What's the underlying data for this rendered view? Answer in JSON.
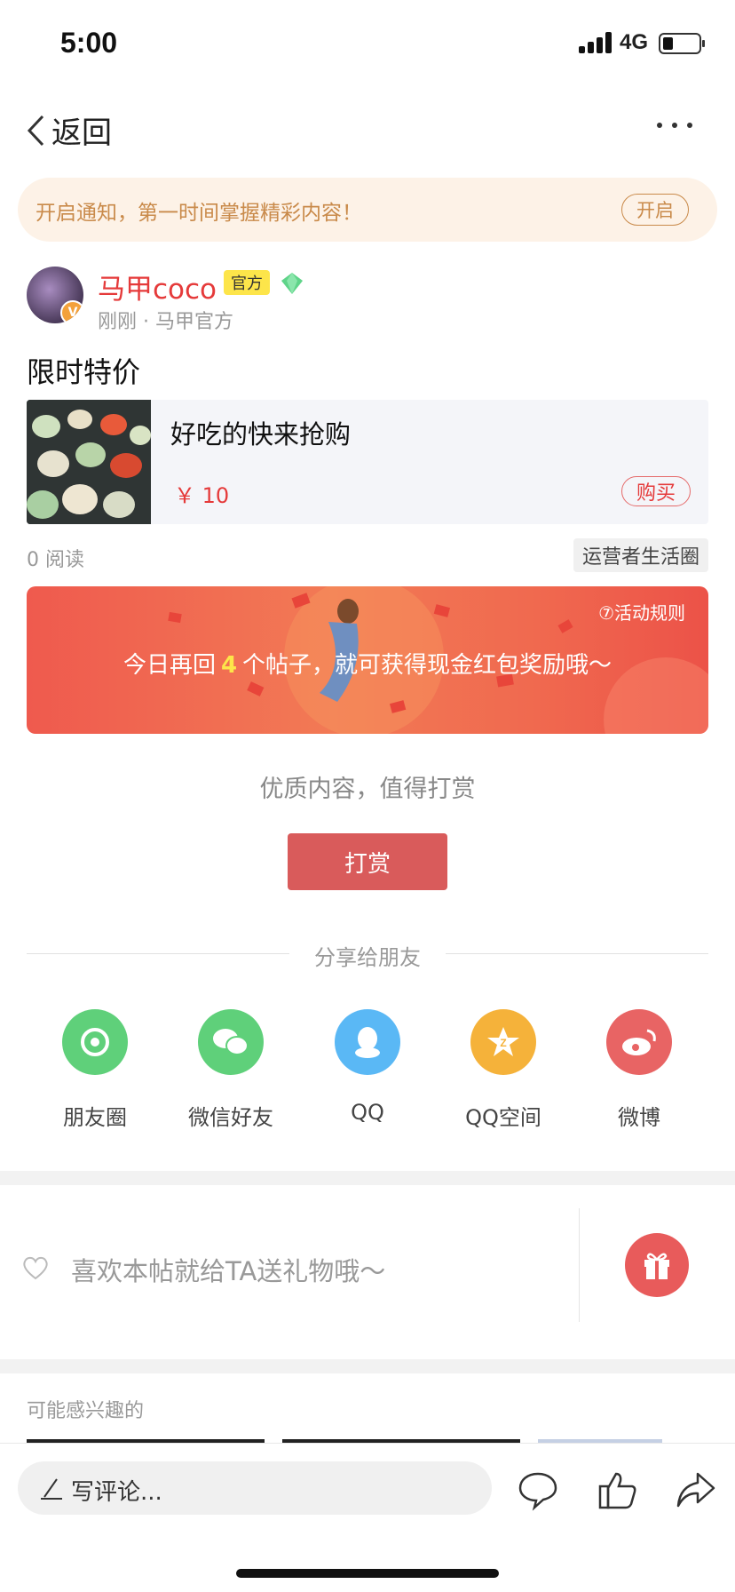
{
  "status_bar": {
    "time": "5:00",
    "network": "4G"
  },
  "nav": {
    "back_label": "返回"
  },
  "notify": {
    "text": "开启通知，第一时间掌握精彩内容！",
    "button": "开启"
  },
  "author": {
    "name": "马甲coco",
    "tag": "官方",
    "meta": "刚刚 · 马甲官方",
    "badge": "V"
  },
  "post": {
    "title": "限时特价"
  },
  "product": {
    "name": "好吃的快来抢购",
    "price": "￥ 10",
    "buy": "购买"
  },
  "stats": {
    "reads": "0 阅读",
    "circle": "运营者生活圈"
  },
  "banner": {
    "rules": "⑦活动规则",
    "msg_before": "今日再回",
    "count": "4",
    "msg_after": "个帖子，就可获得现金红包奖励哦～"
  },
  "reward": {
    "tip": "优质内容，值得打赏",
    "button": "打赏"
  },
  "share": {
    "heading": "分享给朋友",
    "items": [
      {
        "label": "朋友圈",
        "icon": "moments-icon",
        "color": "#5fd07a"
      },
      {
        "label": "微信好友",
        "icon": "wechat-icon",
        "color": "#5fd07a"
      },
      {
        "label": "QQ",
        "icon": "qq-icon",
        "color": "#5ab8f5"
      },
      {
        "label": "QQ空间",
        "icon": "qzone-icon",
        "color": "#f5b23a"
      },
      {
        "label": "微博",
        "icon": "weibo-icon",
        "color": "#e86464"
      }
    ]
  },
  "gift": {
    "text": "喜欢本帖就给TA送礼物哦～"
  },
  "interest": {
    "label": "可能感兴趣的"
  },
  "bottom": {
    "comment_placeholder": "写评论..."
  },
  "colors": {
    "accent_red": "#e53a3a",
    "notify_bg": "#fdf2e7",
    "notify_text": "#c98a4a",
    "reward_button": "#d95b5b"
  }
}
